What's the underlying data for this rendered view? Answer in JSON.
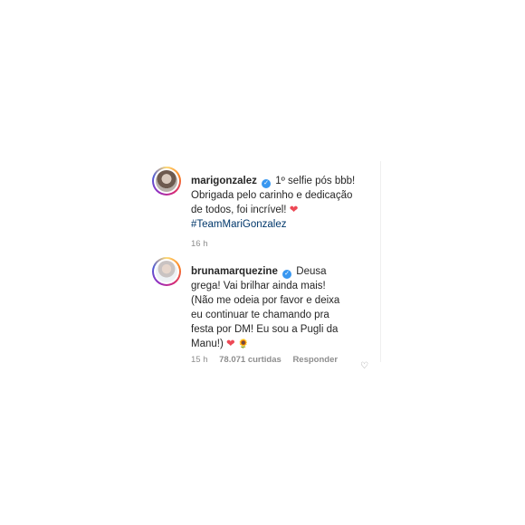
{
  "post": {
    "avatar_icon": "profile-photo",
    "username": "marigonzalez",
    "caption_line1": "1º selfie pós bbb!",
    "caption_line2": "Obrigada pelo carinho e dedicação",
    "caption_line3": "de todos, foi incrível!",
    "caption_heart": "❤",
    "hashtag": "#TeamMariGonzalez",
    "time": "16 h"
  },
  "reply": {
    "avatar_icon": "profile-photo",
    "username": "brunamarquezine",
    "text_line1": "Deusa",
    "text_line2": "grega! Vai brilhar ainda mais!",
    "text_line3": "(Não me odeia por favor e deixa",
    "text_line4": "eu continuar te chamando pra",
    "text_line5": "festa por DM! Eu sou a Pugli da",
    "text_line6": "Manu!)",
    "heart": "❤",
    "sunflower": "🌻",
    "time": "15 h",
    "likes": "78.071 curtidas",
    "reply_label": "Responder",
    "like_icon": "heart-outline"
  },
  "colors": {
    "verified": "#3897f0",
    "hashtag": "#00376b",
    "heart": "#ed4956",
    "meta": "#8e8e8e"
  }
}
